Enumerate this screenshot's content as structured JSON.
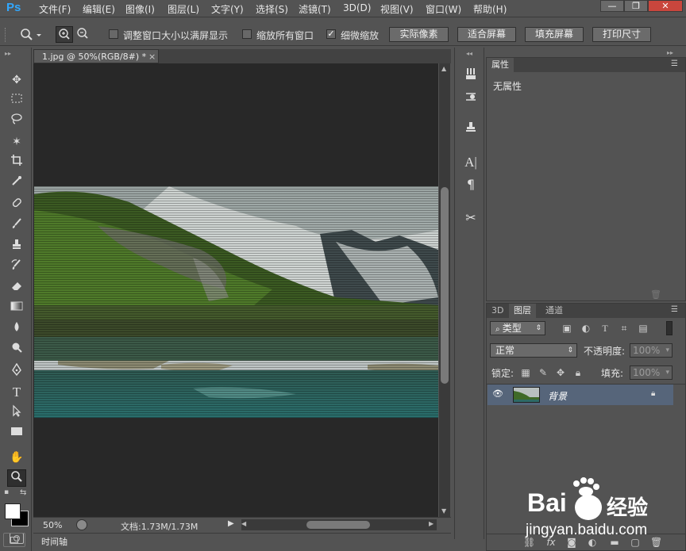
{
  "app": {
    "logo": "Ps"
  },
  "menu": [
    "文件(F)",
    "编辑(E)",
    "图像(I)",
    "图层(L)",
    "文字(Y)",
    "选择(S)",
    "滤镜(T)",
    "3D(D)",
    "视图(V)",
    "窗口(W)",
    "帮助(H)"
  ],
  "window_controls": {
    "minimize": "—",
    "restore": "❐",
    "close": "✕"
  },
  "options": {
    "resize_windows": {
      "label": "调整窗口大小以满屏显示",
      "checked": false
    },
    "zoom_all": {
      "label": "缩放所有窗口",
      "checked": false
    },
    "scrubby_zoom": {
      "label": "细微缩放",
      "checked": true
    },
    "actual_pixels": "实际像素",
    "fit_screen": "适合屏幕",
    "fill_screen": "填充屏幕",
    "print_size": "打印尺寸"
  },
  "document": {
    "tab_title": "1.jpg @ 50%(RGB/8#) *",
    "zoom": "50%",
    "doc_info": "文档:1.73M/1.73M"
  },
  "timeline": {
    "label": "时间轴"
  },
  "properties": {
    "tab": "属性",
    "content": "无属性"
  },
  "layers": {
    "tabs": [
      "3D",
      "图层",
      "通道"
    ],
    "active_tab": "图层",
    "filter_kind": "类型",
    "blend_mode": "正常",
    "opacity_label": "不透明度:",
    "opacity_value": "100%",
    "lock_label": "锁定:",
    "fill_label": "填充:",
    "fill_value": "100%",
    "layer_name": "背景"
  },
  "watermark": {
    "brand_left": "Bai",
    "brand_right": "经验",
    "url": "jingyan.baidu.com"
  },
  "colors": {
    "ui_bg": "#535353",
    "canvas_bg": "#282828",
    "selected_layer": "#56657a",
    "ps_blue": "#31a8ff"
  }
}
